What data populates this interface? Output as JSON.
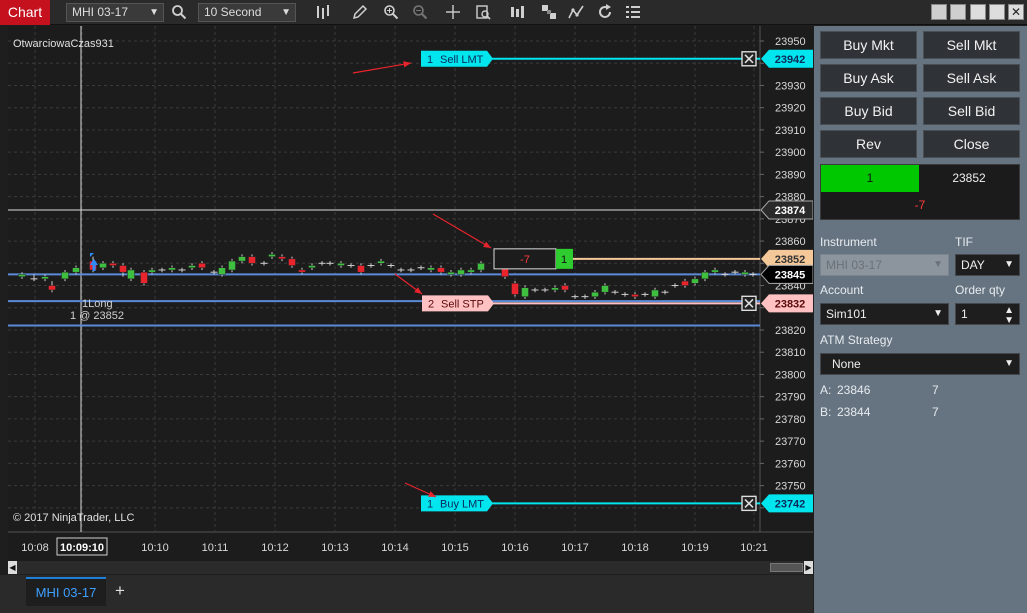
{
  "toolbar": {
    "chart_tab": "Chart",
    "instrument": "MHI 03-17",
    "interval": "10 Second",
    "icons": [
      "bar-type-icon",
      "pencil-icon",
      "zoom-in-icon",
      "zoom-out-icon",
      "crosshair-icon",
      "data-box-icon",
      "indicators-icon",
      "strategies-icon",
      "drawing-tools-icon",
      "reload-icon",
      "properties-icon"
    ]
  },
  "chart": {
    "label": "OtwarciowaCzas931",
    "copyright": "© 2017 NinjaTrader, LLC",
    "price_ticks": [
      23950,
      23940,
      23930,
      23920,
      23910,
      23900,
      23890,
      23880,
      23870,
      23860,
      23850,
      23840,
      23830,
      23820,
      23810,
      23800,
      23790,
      23780,
      23770,
      23760,
      23750,
      23740
    ],
    "time_ticks": [
      "10:08",
      "10:09:10",
      "10:10",
      "10:11",
      "10:12",
      "10:13",
      "10:14",
      "10:15",
      "10:16",
      "10:17",
      "10:18",
      "10:19",
      "10:21"
    ],
    "price_markers": {
      "top": "23942",
      "crosshair": "23874",
      "position": "23852",
      "last": "23845",
      "stop": "23832",
      "bottom": "23742"
    },
    "orders": {
      "sell_lmt": {
        "qty": "1",
        "label": "Sell LMT"
      },
      "sell_stp": {
        "qty": "2",
        "label": "Sell STP"
      },
      "buy_lmt": {
        "qty": "1",
        "label": "Buy LMT"
      }
    },
    "position_pnl": "-7",
    "position_qty": "1",
    "execution": {
      "label": "1Long",
      "detail": "1 @ 23852"
    },
    "colors": {
      "up": "#3fbf3f",
      "down": "#e8242c",
      "limit": "#00e5ee",
      "stop": "#ffc1c1",
      "position": "#f5c89a",
      "level": "#5b8bd8"
    }
  },
  "bottom": {
    "tab": "MHI 03-17",
    "add": "+"
  },
  "panel": {
    "buttons": [
      "Buy Mkt",
      "Sell Mkt",
      "Buy Ask",
      "Sell Ask",
      "Buy Bid",
      "Sell Bid",
      "Rev",
      "Close"
    ],
    "position_qty": "1",
    "position_price": "23852",
    "position_pnl": "-7",
    "instrument_label": "Instrument",
    "instrument_value": "MHI 03-17",
    "tif_label": "TIF",
    "tif_value": "DAY",
    "account_label": "Account",
    "account_value": "Sim101",
    "order_qty_label": "Order qty",
    "order_qty_value": "1",
    "atm_label": "ATM Strategy",
    "atm_value": "None",
    "ask_label": "A:",
    "ask_price": "23846",
    "ask_size": "7",
    "bid_label": "B:",
    "bid_price": "23844",
    "bid_size": "7"
  }
}
